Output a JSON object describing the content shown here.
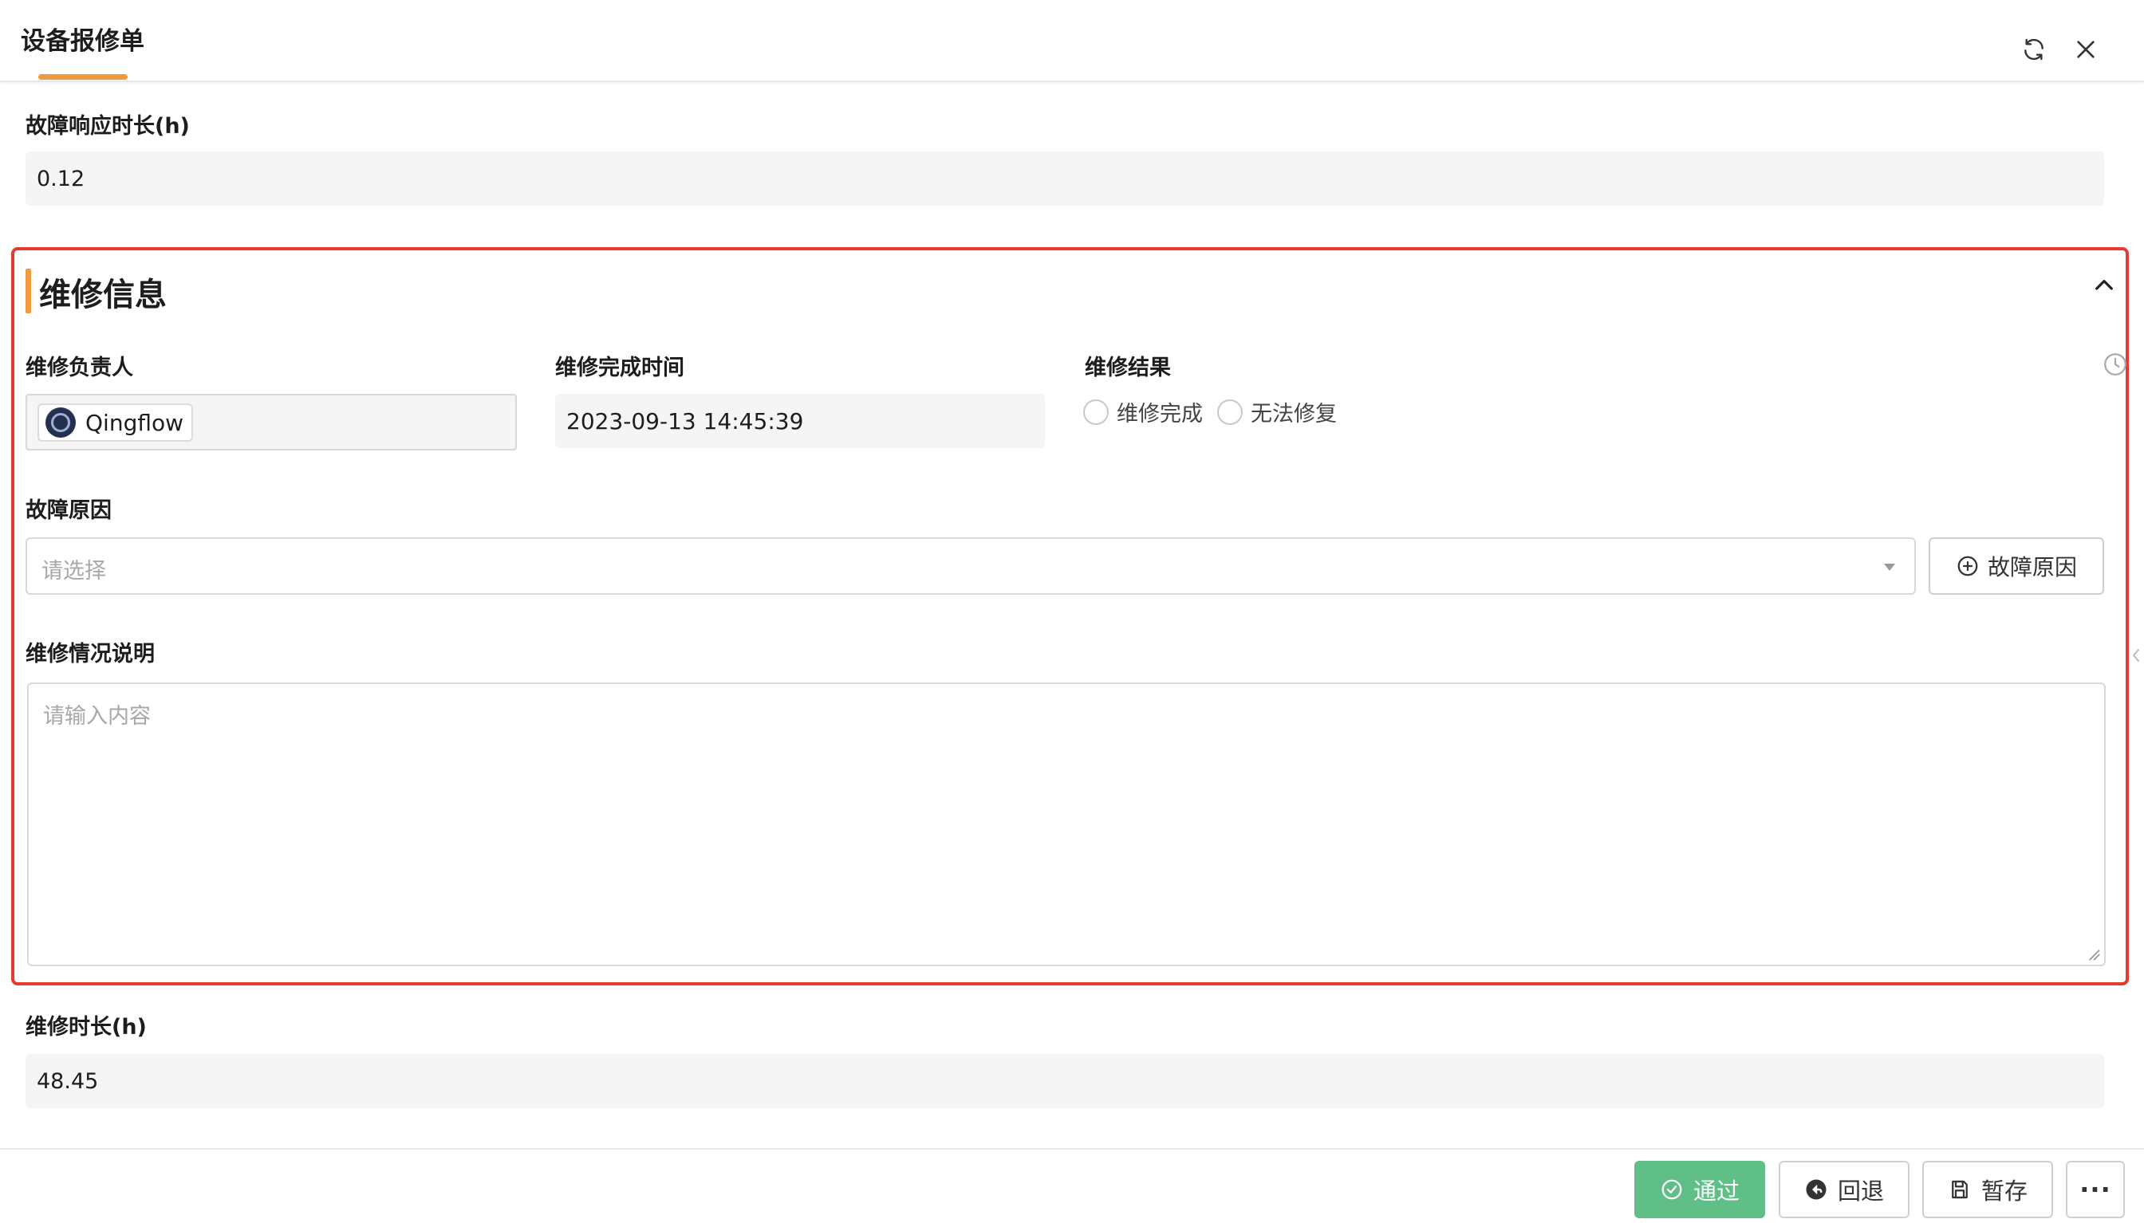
{
  "header": {
    "title": "设备报修单",
    "refresh_icon": "refresh-icon",
    "close_icon": "close-icon"
  },
  "response_field": {
    "label": "故障响应时长(h)",
    "value": "0.12"
  },
  "repair_section": {
    "title": "维修信息",
    "collapse_icon": "chevron-up-icon",
    "owner": {
      "label": "维修负责人",
      "member_name": "Qingflow"
    },
    "complete_time": {
      "label": "维修完成时间",
      "value": "2023-09-13 14:45:39"
    },
    "result": {
      "label": "维修结果",
      "options": [
        "维修完成",
        "无法修复"
      ],
      "selected": null
    },
    "fault_reason": {
      "label": "故障原因",
      "placeholder": "请选择",
      "add_button_label": "故障原因"
    },
    "description": {
      "label": "维修情况说明",
      "placeholder": "请输入内容"
    }
  },
  "duration_field": {
    "label": "维修时长(h)",
    "value": "48.45"
  },
  "footer": {
    "approve_label": "通过",
    "back_label": "回退",
    "save_label": "暂存",
    "more_label": "···"
  },
  "colors": {
    "accent": "#f0993f",
    "highlight_border": "#e23c2e",
    "approve_green": "#5fbf86",
    "readonly_bg": "#f4f5f4"
  }
}
